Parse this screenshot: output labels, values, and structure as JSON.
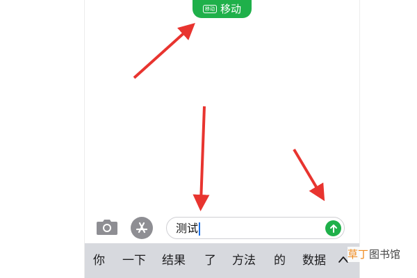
{
  "status_bar": {
    "carrier_badge": "移动",
    "carrier_label": "移动",
    "pill_color": "#1fb04a"
  },
  "composer": {
    "camera_icon": "camera-icon",
    "app_store_icon": "app-store-icon",
    "message_text": "测试",
    "send_icon": "arrow-up-icon"
  },
  "candidate_bar": {
    "candidates": [
      "你",
      "一下",
      "结果",
      "了",
      "方法",
      "的",
      "数据"
    ],
    "expand_icon": "chevron-up-icon"
  },
  "annotations": {
    "arrow_color": "#e8342f",
    "arrow_count": 3
  },
  "watermark": {
    "part1": "草丁",
    "part2": "图书馆"
  }
}
